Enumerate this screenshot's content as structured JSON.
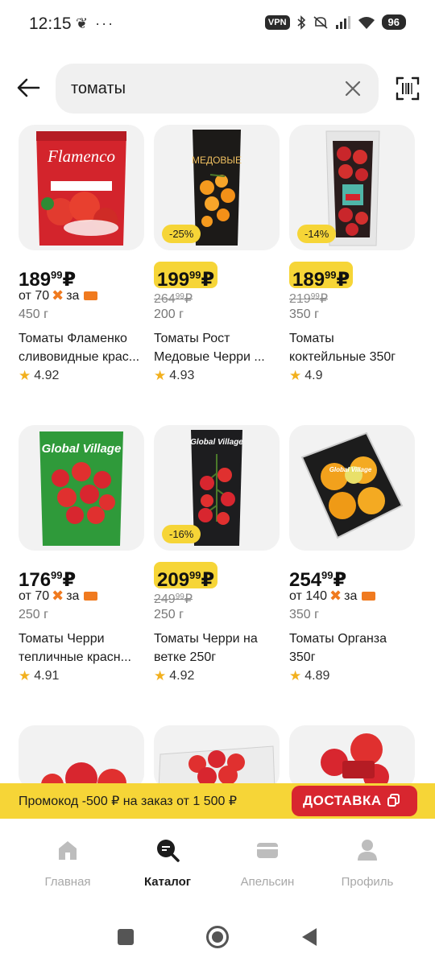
{
  "status_bar": {
    "time": "12:15",
    "left_icons": "❦ ···",
    "vpn": "VPN",
    "battery": "96"
  },
  "search": {
    "query": "томаты"
  },
  "products": [
    {
      "price_rub": "189",
      "price_kop": "99",
      "currency": "₽",
      "promo": false,
      "installment_amount": "от 70",
      "installment_suffix": "за",
      "weight": "450 г",
      "name_line1": "Томаты Фламенко",
      "name_line2": "сливовидные крас...",
      "rating": "4.92",
      "image_label": "Flamenco"
    },
    {
      "price_rub": "199",
      "price_kop": "99",
      "currency": "₽",
      "promo": true,
      "discount": "-25%",
      "old_price_rub": "264",
      "old_price_kop": "99",
      "weight": "200 г",
      "name_line1": "Томаты Рост",
      "name_line2": "Медовые Черри ...",
      "rating": "4.93",
      "image_label": "МЕДОВЫЕ"
    },
    {
      "price_rub": "189",
      "price_kop": "99",
      "currency": "₽",
      "promo": true,
      "discount": "-14%",
      "old_price_rub": "219",
      "old_price_kop": "99",
      "weight": "350 г",
      "name_line1": "Томаты",
      "name_line2": "коктейльные 350г",
      "rating": "4.9"
    },
    {
      "price_rub": "176",
      "price_kop": "99",
      "currency": "₽",
      "promo": false,
      "installment_amount": "от 70",
      "installment_suffix": "за",
      "weight": "250 г",
      "name_line1": "Томаты Черри",
      "name_line2": "тепличные красн...",
      "rating": "4.91",
      "image_label": "Global Village"
    },
    {
      "price_rub": "209",
      "price_kop": "99",
      "currency": "₽",
      "promo": true,
      "discount": "-16%",
      "old_price_rub": "249",
      "old_price_kop": "99",
      "weight": "250 г",
      "name_line1": "Томаты Черри на",
      "name_line2": "ветке 250г",
      "rating": "4.92",
      "image_label": "Global Village"
    },
    {
      "price_rub": "254",
      "price_kop": "99",
      "currency": "₽",
      "promo": false,
      "installment_amount": "от 140",
      "installment_suffix": "за",
      "weight": "350 г",
      "name_line1": "Томаты Органза",
      "name_line2": "350г",
      "rating": "4.89",
      "image_label": "Global Village"
    }
  ],
  "promo_banner": {
    "text": "Промокод -500 ₽ на заказ от 1 500 ₽",
    "tag": "ДОСТАВКА"
  },
  "bottom_nav": [
    {
      "label": "Главная",
      "icon": "home-icon",
      "active": false
    },
    {
      "label": "Каталог",
      "icon": "catalog-search-icon",
      "active": true
    },
    {
      "label": "Апельсин",
      "icon": "card-icon",
      "active": false
    },
    {
      "label": "Профиль",
      "icon": "profile-icon",
      "active": false
    }
  ],
  "colors": {
    "accent_yellow": "#f6d537",
    "accent_red": "#d8262f",
    "installment_orange": "#f07a1f"
  }
}
